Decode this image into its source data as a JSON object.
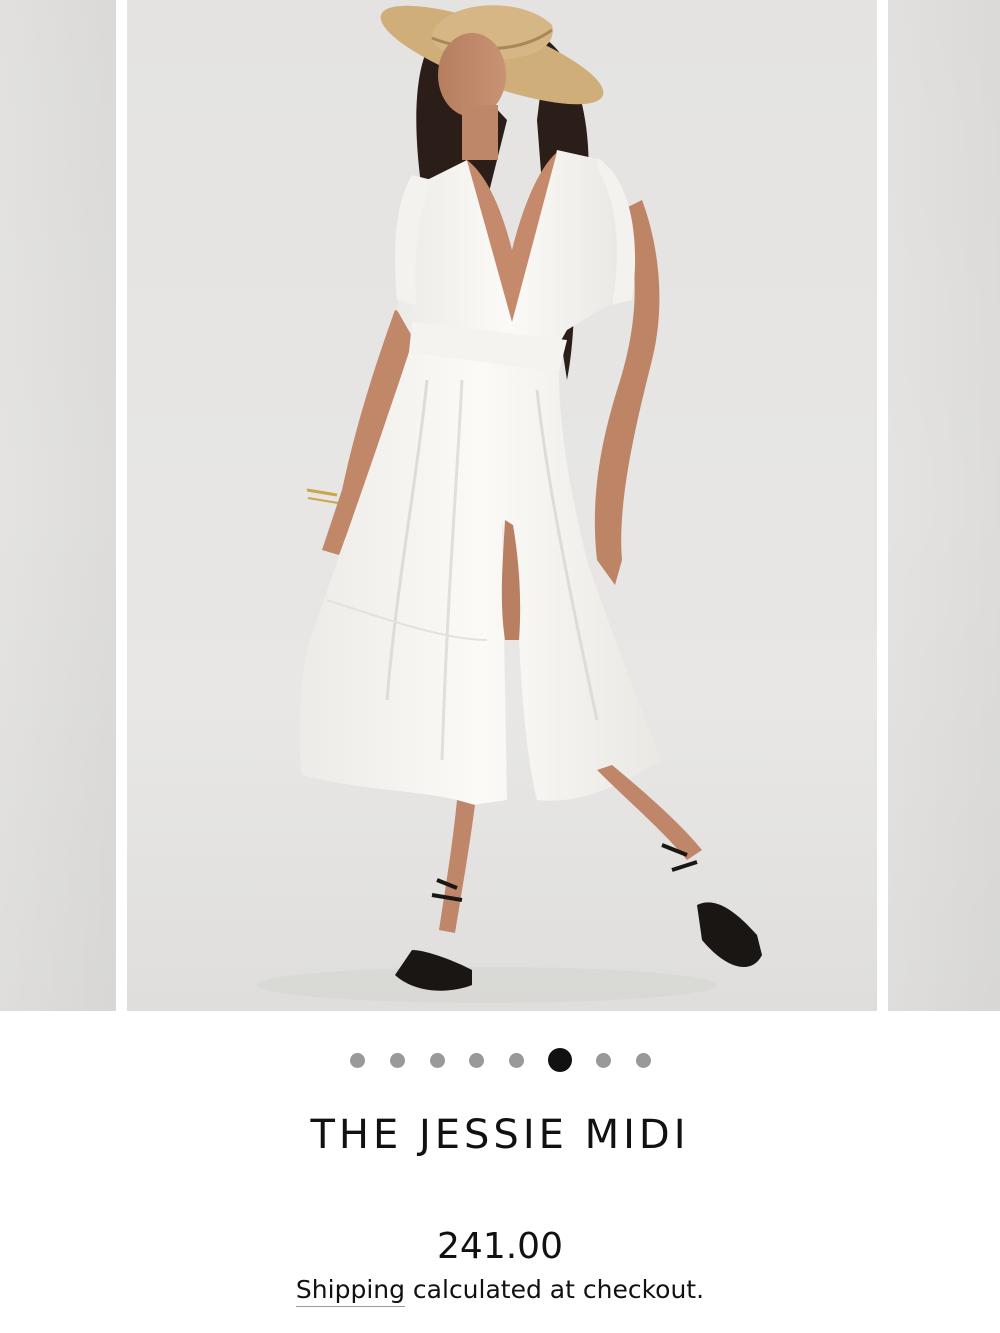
{
  "gallery": {
    "slide_count": 8,
    "active_index": 5,
    "zoom_icon": "search-icon"
  },
  "product": {
    "title": "THE JESSIE MIDI",
    "price": "241.00",
    "shipping_link": "Shipping",
    "shipping_rest": " calculated at checkout."
  },
  "colors": {
    "background": "#ffffff",
    "photo_backdrop": "#e7e6e4",
    "dress": "#f7f6f2",
    "dot_inactive": "#999999",
    "dot_active": "#111111",
    "text": "#111111"
  }
}
